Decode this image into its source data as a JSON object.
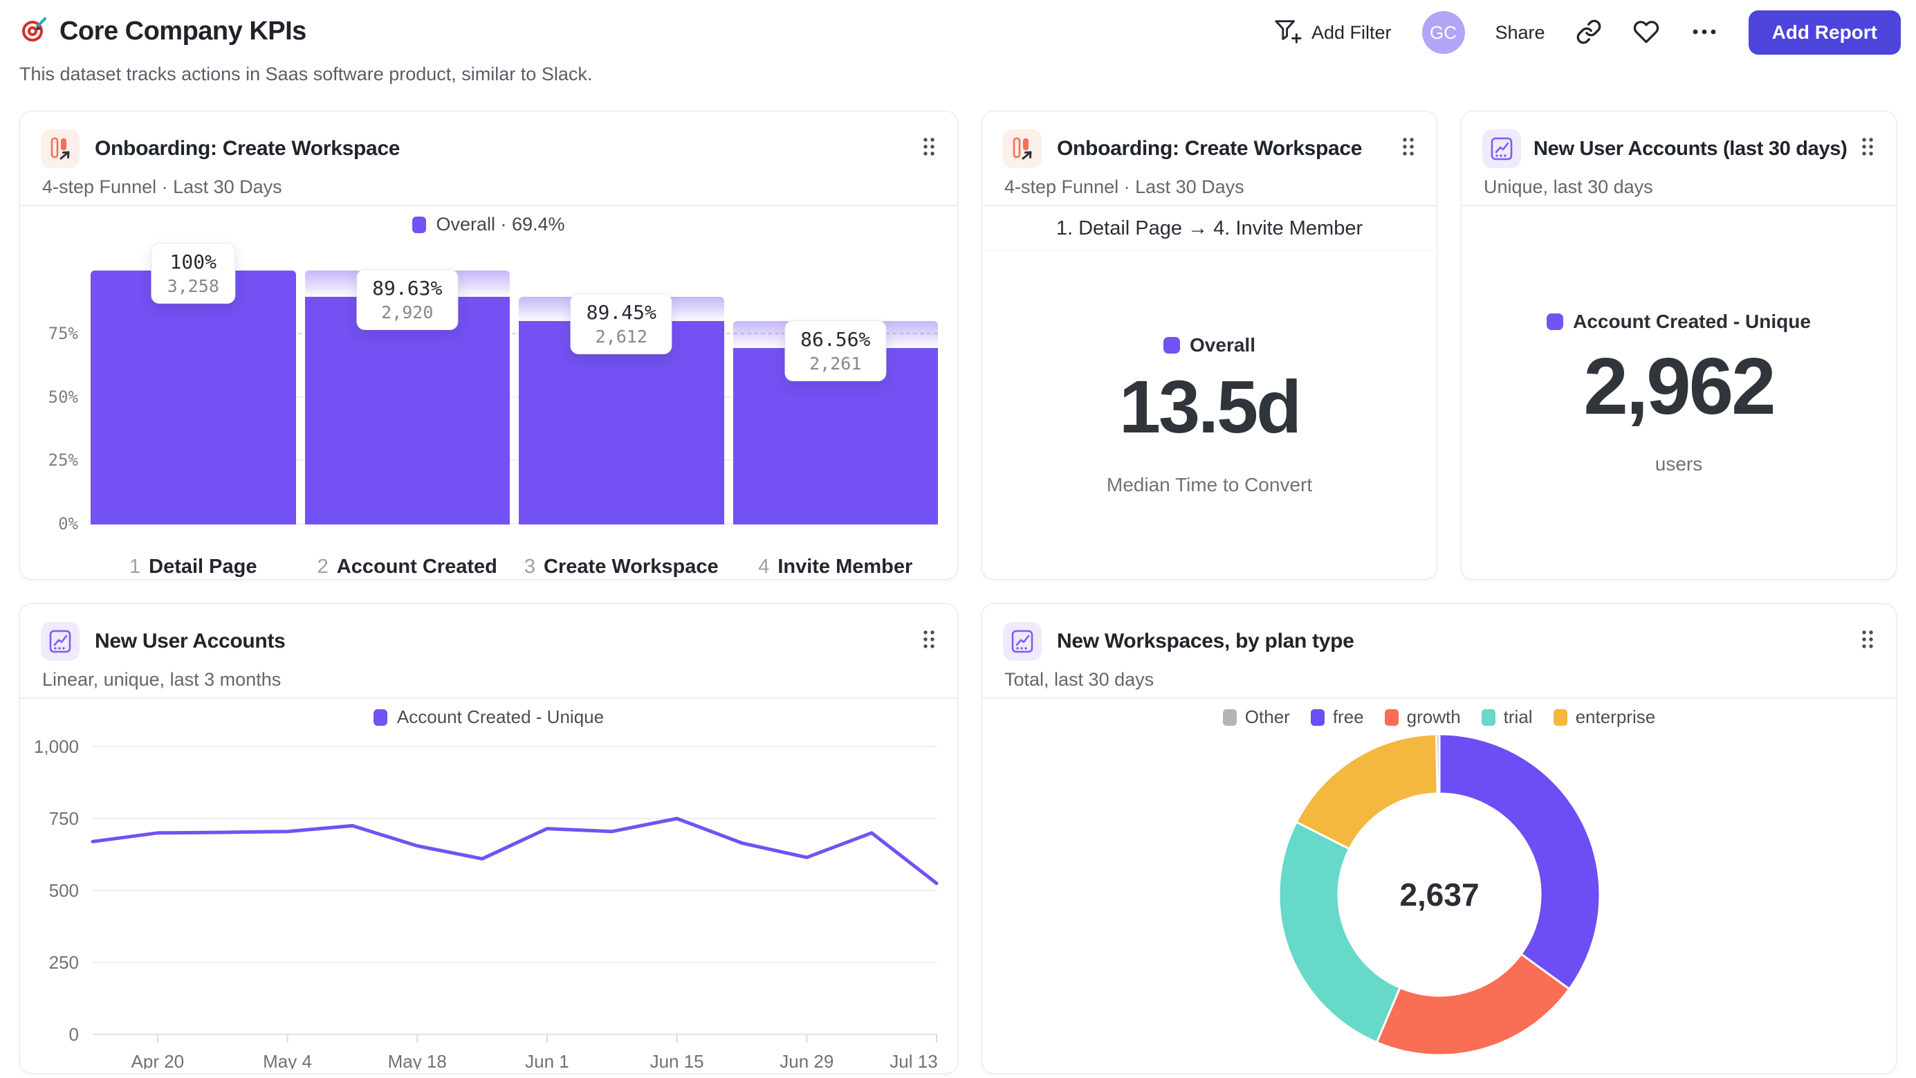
{
  "header": {
    "title": "Core Company KPIs",
    "subtitle": "This dataset tracks actions in Saas software product, similar to Slack.",
    "actions": {
      "add_filter": "Add Filter",
      "avatar_initials": "GC",
      "share": "Share",
      "add_report": "Add Report"
    }
  },
  "icons": {
    "page": "target-icon",
    "add_filter": "filter-plus-icon",
    "link": "link-icon",
    "favorite": "heart-icon",
    "more": "more-icon",
    "drag": "drag-handle-icon",
    "funnel_report": "funnel-report-icon",
    "chart_report": "line-chart-report-icon"
  },
  "cards": {
    "funnel": {
      "title": "Onboarding: Create Workspace",
      "subtitle": "4-step Funnel · Last 30 Days",
      "legend": "Overall · 69.4%"
    },
    "median_time": {
      "title": "Onboarding: Create Workspace",
      "subtitle": "4-step Funnel · Last 30 Days",
      "range_label": "1. Detail Page → 4. Invite Member",
      "legend": "Overall",
      "value": "13.5d",
      "caption": "Median Time to Convert"
    },
    "new_accounts_total": {
      "title": "New User Accounts (last 30 days)",
      "subtitle": "Unique, last 30 days",
      "legend": "Account Created - Unique",
      "value": "2,962",
      "caption": "users"
    },
    "new_accounts_trend": {
      "title": "New User Accounts",
      "subtitle": "Linear, unique, last 3 months",
      "legend": "Account Created - Unique"
    },
    "workspaces_by_plan": {
      "title": "New Workspaces, by plan type",
      "subtitle": "Total, last 30 days",
      "center_total": "2,637"
    }
  },
  "chart_data": [
    {
      "type": "bar",
      "subtype": "funnel",
      "title": "Onboarding: Create Workspace",
      "legend": "Overall · 69.4%",
      "bar_color": "#7351F2",
      "y_ticks": [
        "0%",
        "25%",
        "50%",
        "75%"
      ],
      "steps": [
        {
          "index": "1",
          "label": "Detail Page",
          "conversion_pct": "100%",
          "count": "3,258",
          "height_pct": 100,
          "prev_height_pct": 100
        },
        {
          "index": "2",
          "label": "Account Created",
          "conversion_pct": "89.63%",
          "count": "2,920",
          "height_pct": 89.63,
          "prev_height_pct": 100
        },
        {
          "index": "3",
          "label": "Create Workspace",
          "conversion_pct": "89.45%",
          "count": "2,612",
          "height_pct": 80.17,
          "prev_height_pct": 89.63
        },
        {
          "index": "4",
          "label": "Invite Member",
          "conversion_pct": "86.56%",
          "count": "2,261",
          "height_pct": 69.4,
          "prev_height_pct": 80.17
        }
      ]
    },
    {
      "type": "line",
      "title": "New User Accounts",
      "ylim": [
        0,
        1000
      ],
      "y_ticks": [
        0,
        250,
        500,
        750,
        1000
      ],
      "y_tick_labels": [
        "0",
        "250",
        "500",
        "750",
        "1,000"
      ],
      "x_tick_labels": [
        "Apr 20",
        "May 4",
        "May 18",
        "Jun 1",
        "Jun 15",
        "Jun 29",
        "Jul 13"
      ],
      "grid": true,
      "legend_position": "top",
      "series": [
        {
          "name": "Account Created - Unique",
          "color": "#7351F2",
          "x": [
            "Apr 13",
            "Apr 20",
            "Apr 27",
            "May 4",
            "May 11",
            "May 18",
            "May 25",
            "Jun 1",
            "Jun 8",
            "Jun 15",
            "Jun 22",
            "Jun 29",
            "Jul 6",
            "Jul 13"
          ],
          "values": [
            670,
            700,
            702,
            705,
            725,
            655,
            610,
            715,
            705,
            750,
            665,
            615,
            700,
            525
          ]
        }
      ]
    },
    {
      "type": "pie",
      "subtype": "donut",
      "title": "New Workspaces, by plan type",
      "total_label": "2,637",
      "total": 2637,
      "legend_position": "top",
      "legend_order": [
        "Other",
        "free",
        "growth",
        "trial",
        "enterprise"
      ],
      "slices": [
        {
          "label": "free",
          "value": 923,
          "pct": 35.0,
          "color": "#6C4EF4"
        },
        {
          "label": "growth",
          "value": 564,
          "pct": 21.4,
          "color": "#F96E54"
        },
        {
          "label": "trial",
          "value": 688,
          "pct": 26.1,
          "color": "#66D9C9"
        },
        {
          "label": "enterprise",
          "value": 454,
          "pct": 17.2,
          "color": "#F4B73F"
        },
        {
          "label": "Other",
          "value": 8,
          "pct": 0.3,
          "color": "#B4B4B8"
        }
      ]
    }
  ],
  "colors": {
    "accent": "#7351F2",
    "button_bg": "#4D44DB",
    "avatar_bg": "#B1A5F8"
  }
}
